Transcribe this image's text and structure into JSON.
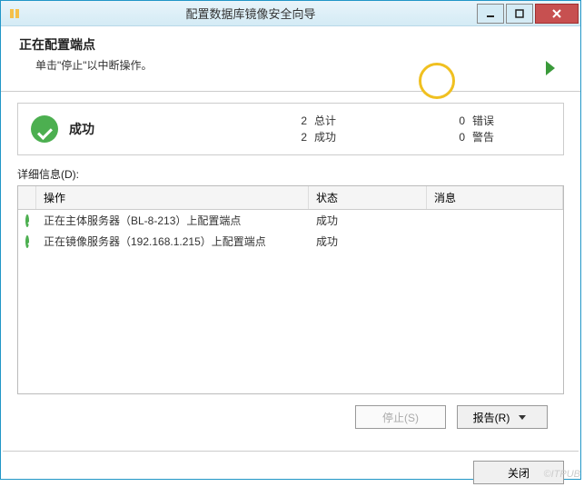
{
  "titlebar": {
    "title": "配置数据库镜像安全向导"
  },
  "header": {
    "title": "正在配置端点",
    "subtitle": "单击\"停止\"以中断操作。"
  },
  "summary": {
    "label": "成功",
    "total_num": "2",
    "total_label": "总计",
    "success_num": "2",
    "success_label": "成功",
    "error_num": "0",
    "error_label": "错误",
    "warn_num": "0",
    "warn_label": "警告"
  },
  "details": {
    "label": "详细信息(D):",
    "columns": {
      "op": "操作",
      "status": "状态",
      "msg": "消息"
    },
    "rows": [
      {
        "op": "正在主体服务器（BL-8-213）上配置端点",
        "status": "成功",
        "msg": ""
      },
      {
        "op": "正在镜像服务器（192.168.1.215）上配置端点",
        "status": "成功",
        "msg": ""
      }
    ]
  },
  "buttons": {
    "stop": "停止(S)",
    "report": "报告(R)",
    "close": "关闭"
  },
  "watermark": "©ITPUB"
}
